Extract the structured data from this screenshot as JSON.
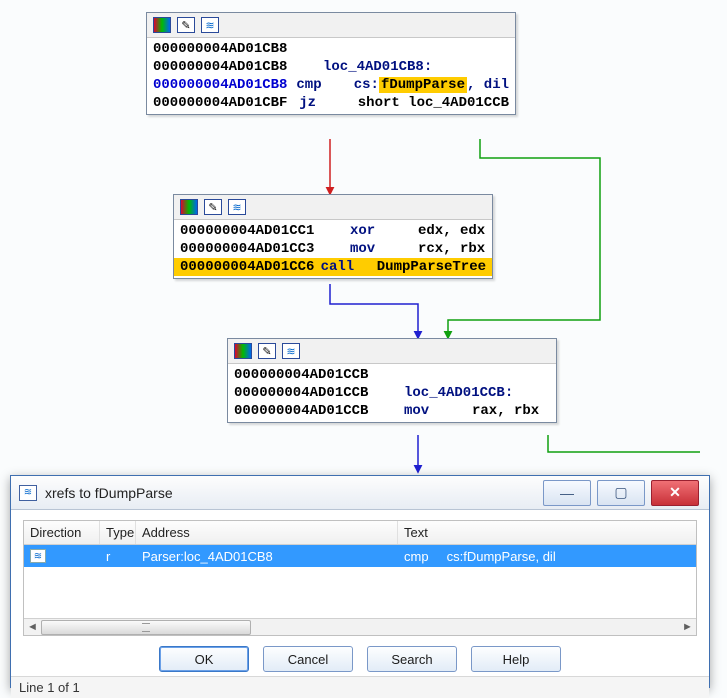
{
  "nodes": {
    "n1": {
      "rows": [
        {
          "addr": "000000004AD01CB8",
          "op": "",
          "args": ""
        },
        {
          "addr": "000000004AD01CB8",
          "op": "loc_4AD01CB8:",
          "args": ""
        },
        {
          "addr_blue": "000000004AD01CB8",
          "op": "cmp",
          "args_pre": "cs:",
          "args_hl": "fDumpParse",
          "args_post": ", dil"
        },
        {
          "addr": "000000004AD01CBF",
          "op": "jz",
          "args": "short loc_4AD01CCB"
        }
      ]
    },
    "n2": {
      "rows": [
        {
          "addr": "000000004AD01CC1",
          "op": "xor",
          "args": "edx, edx"
        },
        {
          "addr": "000000004AD01CC3",
          "op": "mov",
          "args": "rcx, rbx"
        },
        {
          "addr": "000000004AD01CC6",
          "op": "call",
          "args": "DumpParseTree",
          "hl": true
        }
      ]
    },
    "n3": {
      "rows": [
        {
          "addr": "000000004AD01CCB",
          "op": "",
          "args": ""
        },
        {
          "addr": "000000004AD01CCB",
          "op": "loc_4AD01CCB:",
          "args": ""
        },
        {
          "addr": "000000004AD01CCB",
          "op": "mov",
          "args": "rax, rbx"
        }
      ]
    }
  },
  "dialog": {
    "title": "xrefs to fDumpParse",
    "headers": {
      "direction": "Direction",
      "type": "Type",
      "address": "Address",
      "text": "Text"
    },
    "row": {
      "direction": "",
      "type": "r",
      "address": "Parser:loc_4AD01CB8",
      "text": "cmp     cs:fDumpParse, dil"
    },
    "buttons": {
      "ok": "OK",
      "cancel": "Cancel",
      "search": "Search",
      "help": "Help"
    },
    "status": "Line 1 of 1"
  }
}
